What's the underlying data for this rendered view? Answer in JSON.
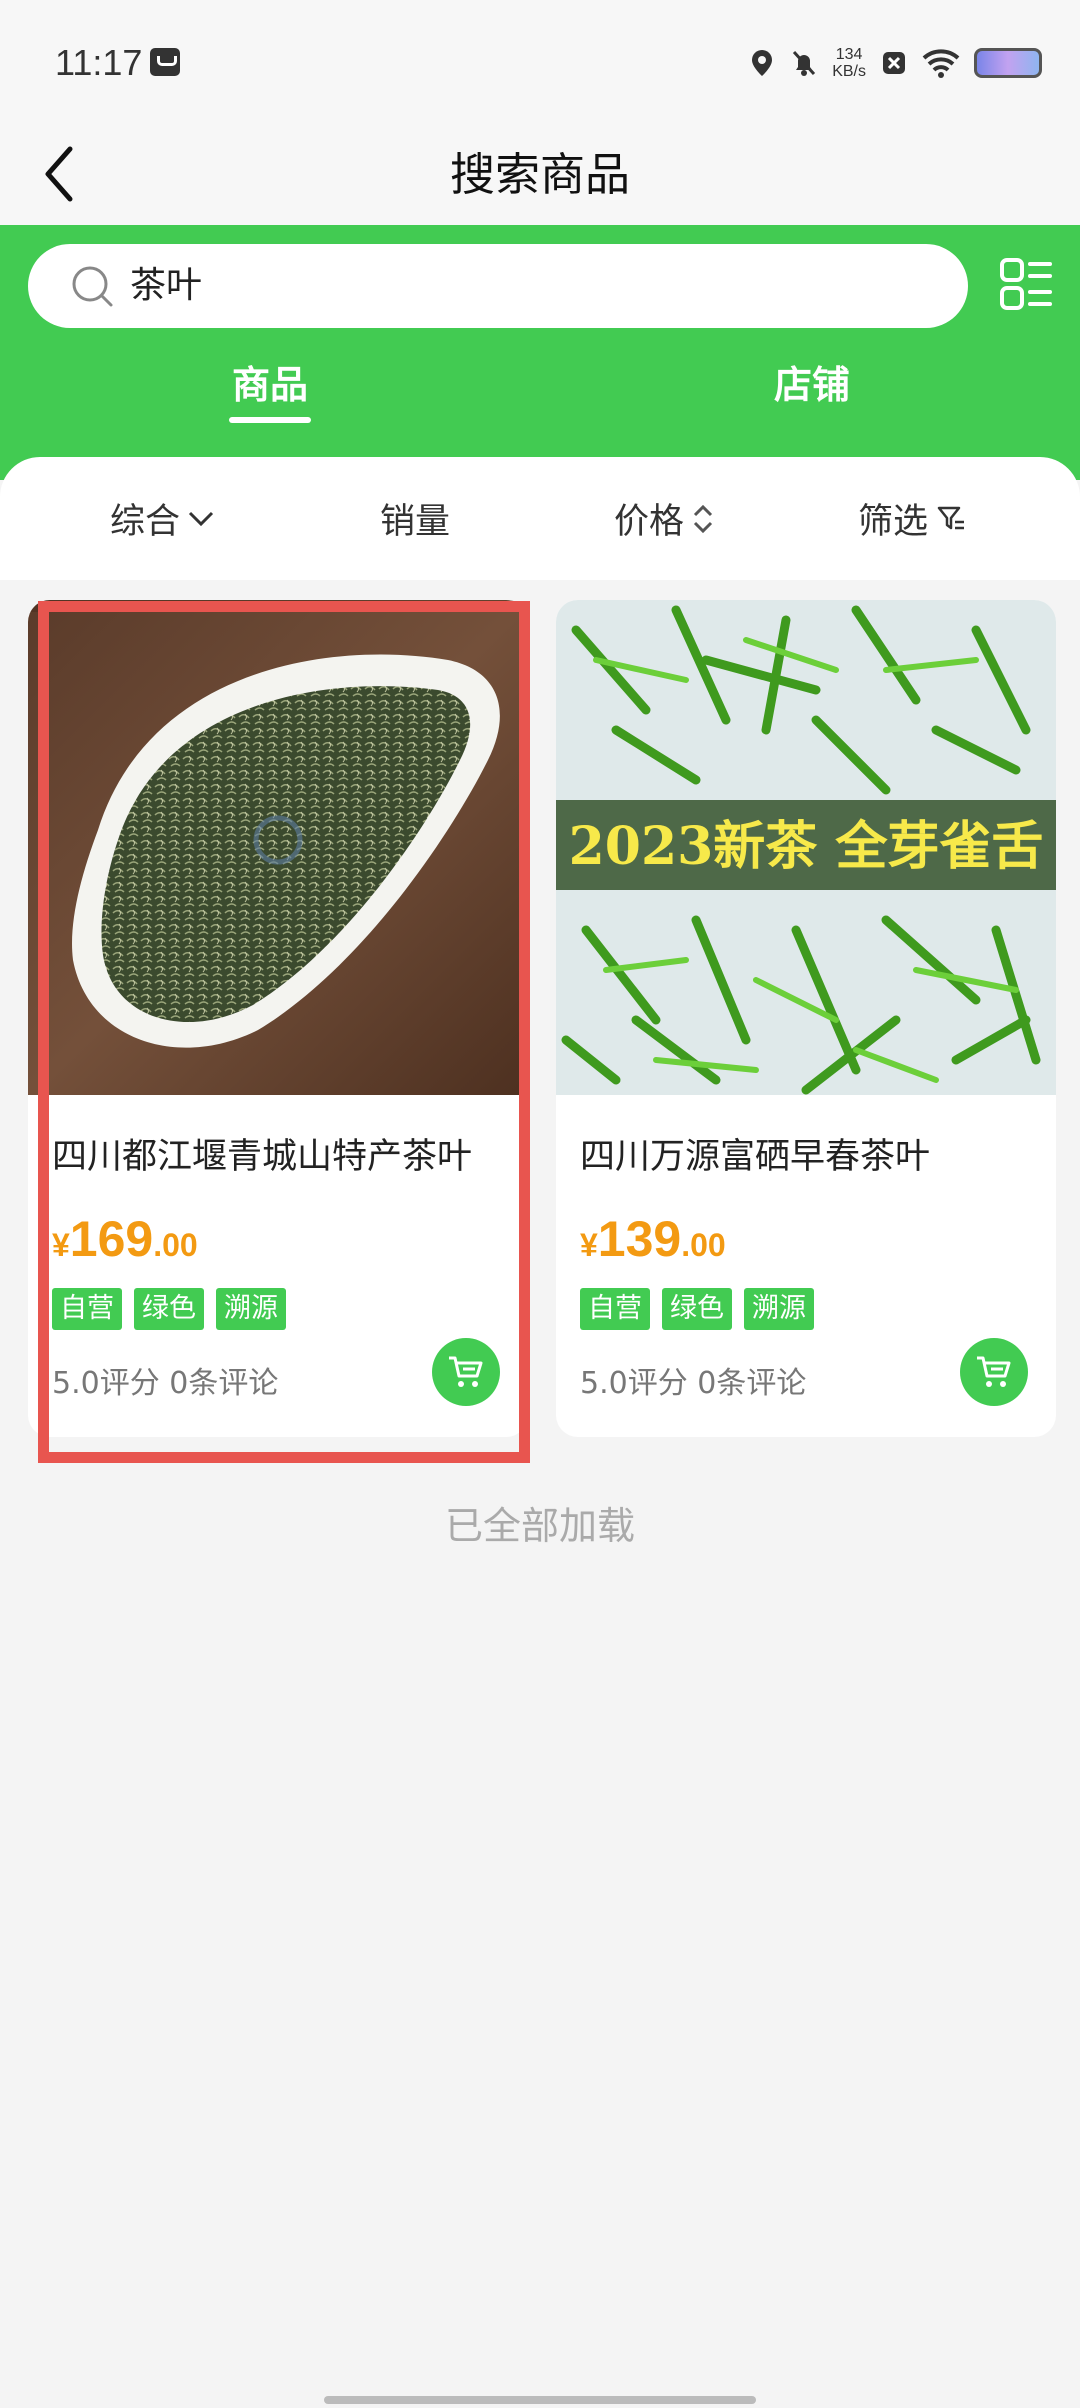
{
  "status": {
    "time": "11:17",
    "net_speed": "134",
    "net_unit": "KB/s"
  },
  "header": {
    "title": "搜索商品"
  },
  "search": {
    "query": "茶叶"
  },
  "tabs": [
    {
      "label": "商品"
    },
    {
      "label": "店铺"
    }
  ],
  "sort": [
    {
      "label": "综合"
    },
    {
      "label": "销量"
    },
    {
      "label": "价格"
    },
    {
      "label": "筛选"
    }
  ],
  "products": [
    {
      "name": "四川都江堰青城山特产茶叶",
      "yen": "¥",
      "price_int": "169",
      "price_dec": ".00",
      "tags": [
        "自营",
        "绿色",
        "溯源"
      ],
      "rating": "5.0评分 0条评论"
    },
    {
      "name": "四川万源富硒早春茶叶",
      "yen": "¥",
      "price_int": "139",
      "price_dec": ".00",
      "tags": [
        "自营",
        "绿色",
        "溯源"
      ],
      "rating": "5.0评分 0条评论",
      "banner": "2023新茶 全芽雀舌"
    }
  ],
  "footer": {
    "loaded_text": "已全部加载"
  },
  "colors": {
    "accent": "#42cb52",
    "price": "#f39a12",
    "highlight": "#e8554f"
  }
}
